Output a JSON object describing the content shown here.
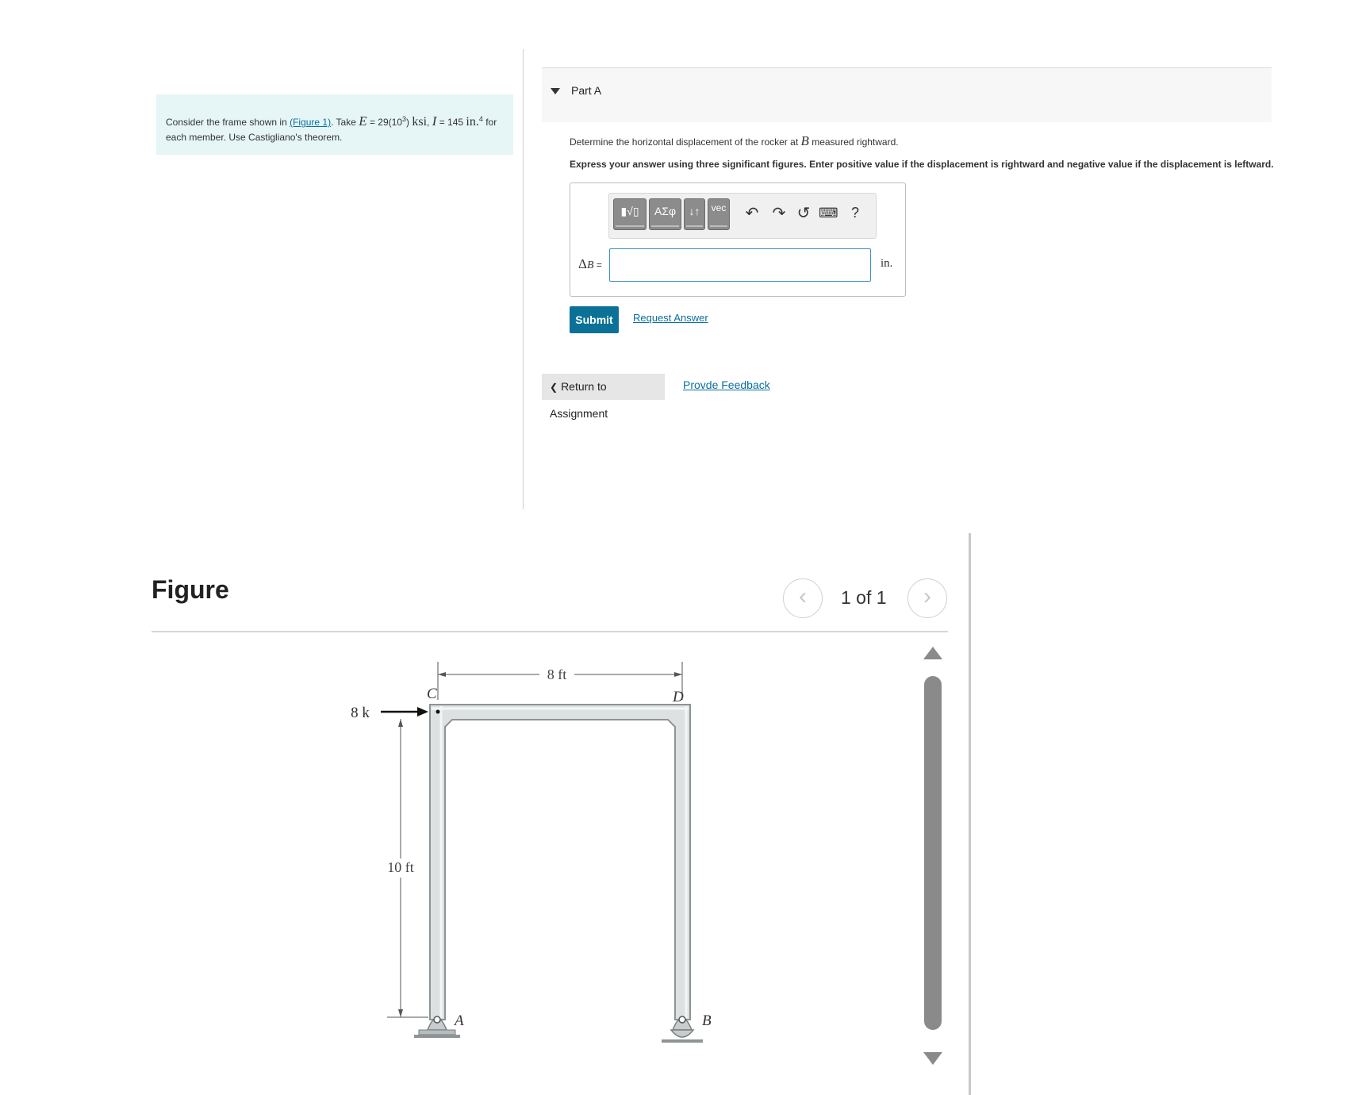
{
  "problem": {
    "prefix": "Consider the frame shown in ",
    "figure_link": "(Figure 1)",
    "take": ". Take ",
    "E_sym": "E",
    "E_value": " = 29(10",
    "E_exp": "3",
    "E_close": ") ",
    "E_unit": "ksi",
    "sep": ", ",
    "I_sym": "I",
    "I_value": " = 145 ",
    "I_unit": "in.",
    "I_exp": "4",
    "suffix_line1": " for",
    "line2": "each member. Use Castigliano's theorem."
  },
  "part_a": {
    "title": "Part A",
    "question_pre": "Determine the horizontal displacement of the rocker at ",
    "question_sym": "B",
    "question_post": " measured rightward.",
    "instruction": "Express your answer using three significant figures. Enter positive value if the displacement is rightward and negative value if the displacement is leftward.",
    "toolbar": {
      "templates": "▮√▯",
      "greek": "ΑΣφ",
      "arrows": "↓↑",
      "vec": "vec",
      "undo": "↶",
      "redo": "↷",
      "reset": "↺",
      "keyboard": "⌨",
      "help": "?"
    },
    "label_delta": "Δ",
    "label_sub": "B",
    "label_eq": " =",
    "answer_value": "",
    "unit": "in.",
    "submit": "Submit",
    "request_answer": "Request Answer"
  },
  "nav": {
    "return": "Return to Assignment",
    "return_icon": "❮",
    "feedback": "Provde Feedback"
  },
  "figure": {
    "title": "Figure",
    "pager": "1 of 1",
    "prev_icon": "‹",
    "next_icon": "›",
    "labels": {
      "load": "8 k",
      "span": "8 ft",
      "height": "10 ft",
      "C": "C",
      "D": "D",
      "A": "A",
      "B": "B"
    },
    "colors": {
      "member": "#dde1e2",
      "member_edge": "#8e9496"
    }
  }
}
